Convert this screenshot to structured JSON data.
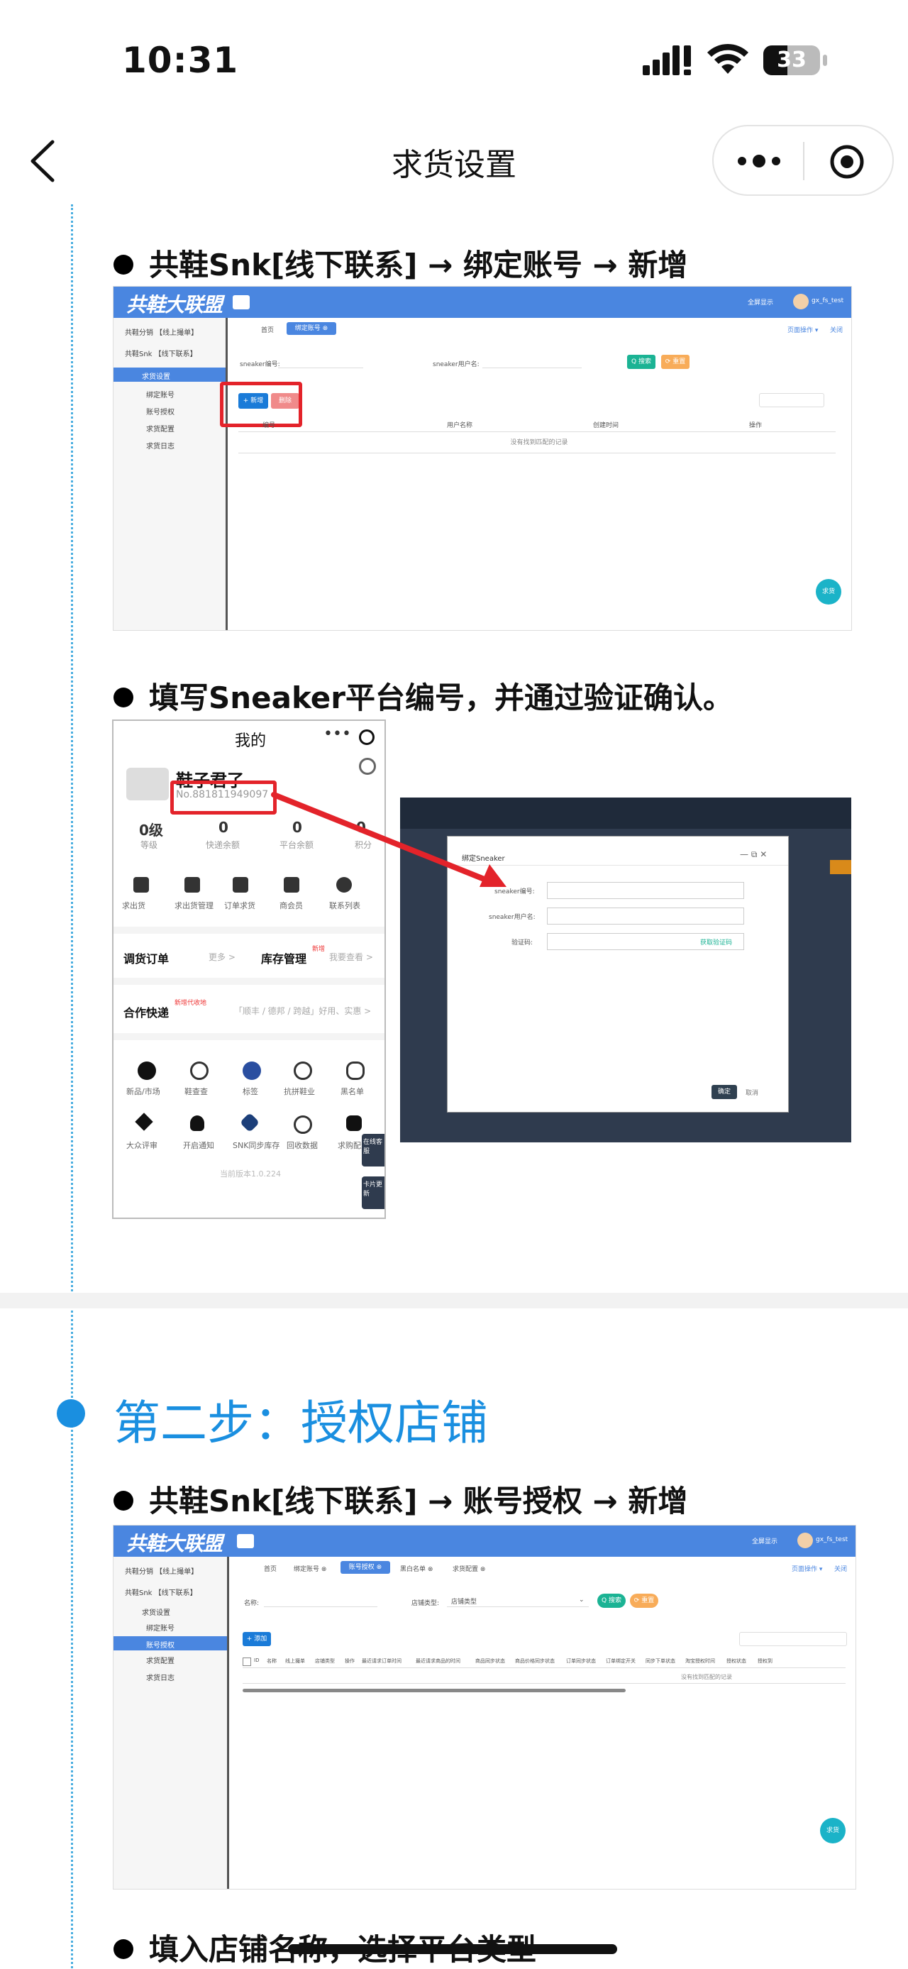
{
  "status": {
    "time": "10:31",
    "battery": "33"
  },
  "nav": {
    "title": "求货设置"
  },
  "section1": {
    "heading1": "共鞋Snk[线下联系] →   绑定账号 → 新增",
    "heading2": "填写Sneaker平台编号，并通过验证确认。"
  },
  "admin1": {
    "logo": "共鞋大联盟",
    "menu": [
      "共鞋分销 【线上撮单】",
      "共鞋Snk 【线下联系】",
      "求货设置",
      "绑定账号",
      "账号授权",
      "求货配置",
      "求货日志"
    ],
    "tabs": [
      "首页",
      "绑定账号 ⊗"
    ],
    "search_label_1": "sneaker编号:",
    "search_label_2": "sneaker用户名:",
    "search_btn": "Q 搜索",
    "reset_btn": "⟳ 重置",
    "add_btn": "+ 新增",
    "delete_btn": "删除",
    "columns": [
      "编号",
      "用户名称",
      "创建时间",
      "操作"
    ],
    "empty_text": "没有找到匹配的记录",
    "float_btn": "求货",
    "user": "gx_fs_test",
    "fullscreen": "全屏显示",
    "page_ops": "页面操作 ▾",
    "close_all": "关闭"
  },
  "phone": {
    "title": "我的",
    "name": "鞋子君了",
    "no": "No.881811949097",
    "stats": [
      {
        "value": "0级",
        "label": "等级"
      },
      {
        "value": "0",
        "label": "快递余额"
      },
      {
        "value": "0",
        "label": "平台余额"
      },
      {
        "value": "0",
        "label": "积分"
      }
    ],
    "icons_row": [
      "求出货",
      "求出货管理",
      "订单求货",
      "商会员",
      "联系列表"
    ],
    "orders": "调货订单",
    "orders_more": "更多 >",
    "inventory": "库存管理",
    "inventory_badge": "新增",
    "inventory_more": "我要查看 >",
    "express": "合作快递",
    "express_badge": "新增代收地",
    "express_more": "「顺丰 / 德邦 / 跨越」好用、实惠 >",
    "grid1": [
      "新品/市场",
      "鞋查查",
      "标签",
      "抗拼鞋业",
      "黑名单"
    ],
    "grid2": [
      "大众评审",
      "开启通知",
      "SNK同步库存",
      "回收数据",
      "求购配置"
    ],
    "version": "当前版本1.0.224",
    "side_btn1": "在线客服",
    "side_btn2": "卡片更新"
  },
  "modal": {
    "title": "绑定Sneaker",
    "field1": "sneaker编号:",
    "field2": "sneaker用户名:",
    "field3": "验证码:",
    "verify_link": "获取验证码",
    "ok": "确定",
    "cancel": "取消"
  },
  "section2": {
    "step_title": "第二步：授权店铺",
    "heading": "共鞋Snk[线下联系] →  账号授权 → 新增",
    "heading2": "填入店铺名称，选择平台类型"
  },
  "admin2": {
    "logo": "共鞋大联盟",
    "menu": [
      "共鞋分销 【线上撮单】",
      "共鞋Snk 【线下联系】",
      "求货设置",
      "绑定账号",
      "账号授权",
      "求货配置",
      "求货日志"
    ],
    "tabs": [
      "首页",
      "绑定账号 ⊗",
      "账号授权 ⊗",
      "黑白名单 ⊗",
      "求货配置 ⊗"
    ],
    "name_label": "名称:",
    "type_label": "店铺类型:",
    "type_select": "店铺类型",
    "search_btn": "Q 搜索",
    "reset_btn": "⟳ 重置",
    "add_btn": "+ 添加",
    "columns": [
      "ID",
      "名称",
      "线上撮单",
      "店铺类型",
      "操作",
      "最近请求订单时间",
      "最近请求商品的时间",
      "商品同步状态",
      "商品价格同步状态",
      "订单同步状态",
      "订单绑定开关",
      "同步下单状态",
      "淘宝授权时间",
      "授权状态",
      "授权到"
    ],
    "empty_text": "没有找到匹配的记录",
    "float_btn": "求货",
    "user": "gx_fs_test",
    "fullscreen": "全屏显示",
    "page_ops": "页面操作 ▾",
    "close_all": "关闭"
  },
  "colors": {
    "accent": "#1a8fe0",
    "admin_blue": "#4a86e0",
    "red_highlight": "#e3232a"
  }
}
